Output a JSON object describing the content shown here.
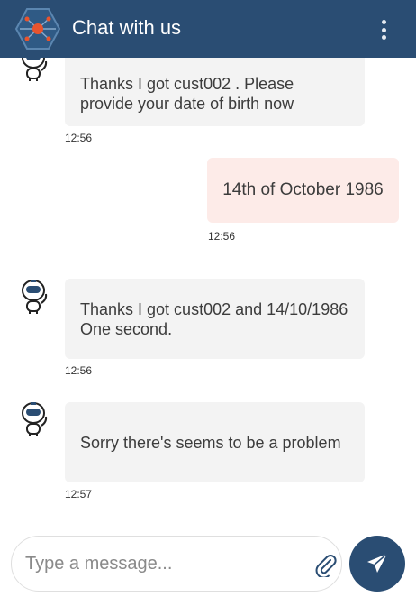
{
  "header": {
    "title": "Chat with us"
  },
  "messages": [
    {
      "sender": "bot",
      "text": "Thanks I got cust002 . Please provide your date of birth now",
      "time": "12:56"
    },
    {
      "sender": "user",
      "text": "14th of October 1986",
      "time": "12:56"
    },
    {
      "sender": "bot",
      "text": "Thanks I got cust002 and 14/10/1986 One second.",
      "time": "12:56"
    },
    {
      "sender": "bot",
      "text": "Sorry there's seems to be a problem",
      "time": "12:57"
    }
  ],
  "composer": {
    "placeholder": "Type a message..."
  },
  "icons": {
    "logo": "hexagon-network-logo",
    "menu": "kebab-menu-icon",
    "avatar": "robot-avatar-icon",
    "attach": "paperclip-icon",
    "send": "send-plane-icon"
  },
  "colors": {
    "header": "#2a4d73",
    "bot_bubble": "#f3f3f3",
    "user_bubble": "#fdebe8",
    "logo_accent": "#e8542e"
  }
}
